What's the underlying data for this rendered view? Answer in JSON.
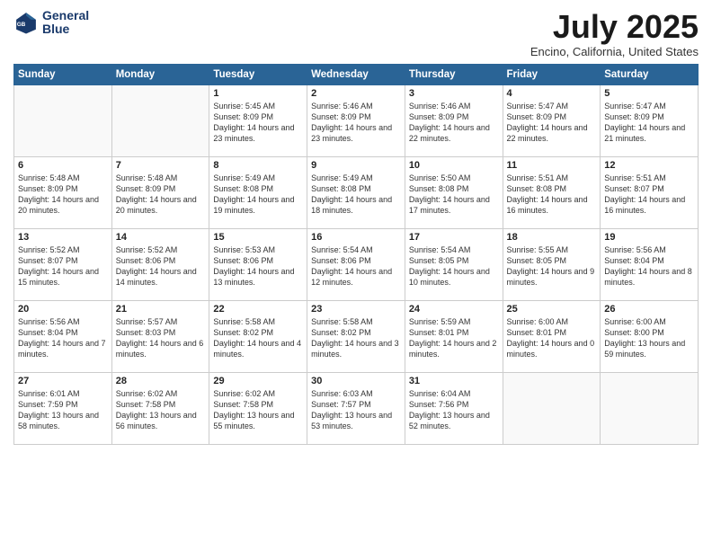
{
  "header": {
    "logo_line1": "General",
    "logo_line2": "Blue",
    "month_title": "July 2025",
    "location": "Encino, California, United States"
  },
  "weekdays": [
    "Sunday",
    "Monday",
    "Tuesday",
    "Wednesday",
    "Thursday",
    "Friday",
    "Saturday"
  ],
  "weeks": [
    [
      {
        "day": "",
        "info": ""
      },
      {
        "day": "",
        "info": ""
      },
      {
        "day": "1",
        "info": "Sunrise: 5:45 AM\nSunset: 8:09 PM\nDaylight: 14 hours and 23 minutes."
      },
      {
        "day": "2",
        "info": "Sunrise: 5:46 AM\nSunset: 8:09 PM\nDaylight: 14 hours and 23 minutes."
      },
      {
        "day": "3",
        "info": "Sunrise: 5:46 AM\nSunset: 8:09 PM\nDaylight: 14 hours and 22 minutes."
      },
      {
        "day": "4",
        "info": "Sunrise: 5:47 AM\nSunset: 8:09 PM\nDaylight: 14 hours and 22 minutes."
      },
      {
        "day": "5",
        "info": "Sunrise: 5:47 AM\nSunset: 8:09 PM\nDaylight: 14 hours and 21 minutes."
      }
    ],
    [
      {
        "day": "6",
        "info": "Sunrise: 5:48 AM\nSunset: 8:09 PM\nDaylight: 14 hours and 20 minutes."
      },
      {
        "day": "7",
        "info": "Sunrise: 5:48 AM\nSunset: 8:09 PM\nDaylight: 14 hours and 20 minutes."
      },
      {
        "day": "8",
        "info": "Sunrise: 5:49 AM\nSunset: 8:08 PM\nDaylight: 14 hours and 19 minutes."
      },
      {
        "day": "9",
        "info": "Sunrise: 5:49 AM\nSunset: 8:08 PM\nDaylight: 14 hours and 18 minutes."
      },
      {
        "day": "10",
        "info": "Sunrise: 5:50 AM\nSunset: 8:08 PM\nDaylight: 14 hours and 17 minutes."
      },
      {
        "day": "11",
        "info": "Sunrise: 5:51 AM\nSunset: 8:08 PM\nDaylight: 14 hours and 16 minutes."
      },
      {
        "day": "12",
        "info": "Sunrise: 5:51 AM\nSunset: 8:07 PM\nDaylight: 14 hours and 16 minutes."
      }
    ],
    [
      {
        "day": "13",
        "info": "Sunrise: 5:52 AM\nSunset: 8:07 PM\nDaylight: 14 hours and 15 minutes."
      },
      {
        "day": "14",
        "info": "Sunrise: 5:52 AM\nSunset: 8:06 PM\nDaylight: 14 hours and 14 minutes."
      },
      {
        "day": "15",
        "info": "Sunrise: 5:53 AM\nSunset: 8:06 PM\nDaylight: 14 hours and 13 minutes."
      },
      {
        "day": "16",
        "info": "Sunrise: 5:54 AM\nSunset: 8:06 PM\nDaylight: 14 hours and 12 minutes."
      },
      {
        "day": "17",
        "info": "Sunrise: 5:54 AM\nSunset: 8:05 PM\nDaylight: 14 hours and 10 minutes."
      },
      {
        "day": "18",
        "info": "Sunrise: 5:55 AM\nSunset: 8:05 PM\nDaylight: 14 hours and 9 minutes."
      },
      {
        "day": "19",
        "info": "Sunrise: 5:56 AM\nSunset: 8:04 PM\nDaylight: 14 hours and 8 minutes."
      }
    ],
    [
      {
        "day": "20",
        "info": "Sunrise: 5:56 AM\nSunset: 8:04 PM\nDaylight: 14 hours and 7 minutes."
      },
      {
        "day": "21",
        "info": "Sunrise: 5:57 AM\nSunset: 8:03 PM\nDaylight: 14 hours and 6 minutes."
      },
      {
        "day": "22",
        "info": "Sunrise: 5:58 AM\nSunset: 8:02 PM\nDaylight: 14 hours and 4 minutes."
      },
      {
        "day": "23",
        "info": "Sunrise: 5:58 AM\nSunset: 8:02 PM\nDaylight: 14 hours and 3 minutes."
      },
      {
        "day": "24",
        "info": "Sunrise: 5:59 AM\nSunset: 8:01 PM\nDaylight: 14 hours and 2 minutes."
      },
      {
        "day": "25",
        "info": "Sunrise: 6:00 AM\nSunset: 8:01 PM\nDaylight: 14 hours and 0 minutes."
      },
      {
        "day": "26",
        "info": "Sunrise: 6:00 AM\nSunset: 8:00 PM\nDaylight: 13 hours and 59 minutes."
      }
    ],
    [
      {
        "day": "27",
        "info": "Sunrise: 6:01 AM\nSunset: 7:59 PM\nDaylight: 13 hours and 58 minutes."
      },
      {
        "day": "28",
        "info": "Sunrise: 6:02 AM\nSunset: 7:58 PM\nDaylight: 13 hours and 56 minutes."
      },
      {
        "day": "29",
        "info": "Sunrise: 6:02 AM\nSunset: 7:58 PM\nDaylight: 13 hours and 55 minutes."
      },
      {
        "day": "30",
        "info": "Sunrise: 6:03 AM\nSunset: 7:57 PM\nDaylight: 13 hours and 53 minutes."
      },
      {
        "day": "31",
        "info": "Sunrise: 6:04 AM\nSunset: 7:56 PM\nDaylight: 13 hours and 52 minutes."
      },
      {
        "day": "",
        "info": ""
      },
      {
        "day": "",
        "info": ""
      }
    ]
  ]
}
